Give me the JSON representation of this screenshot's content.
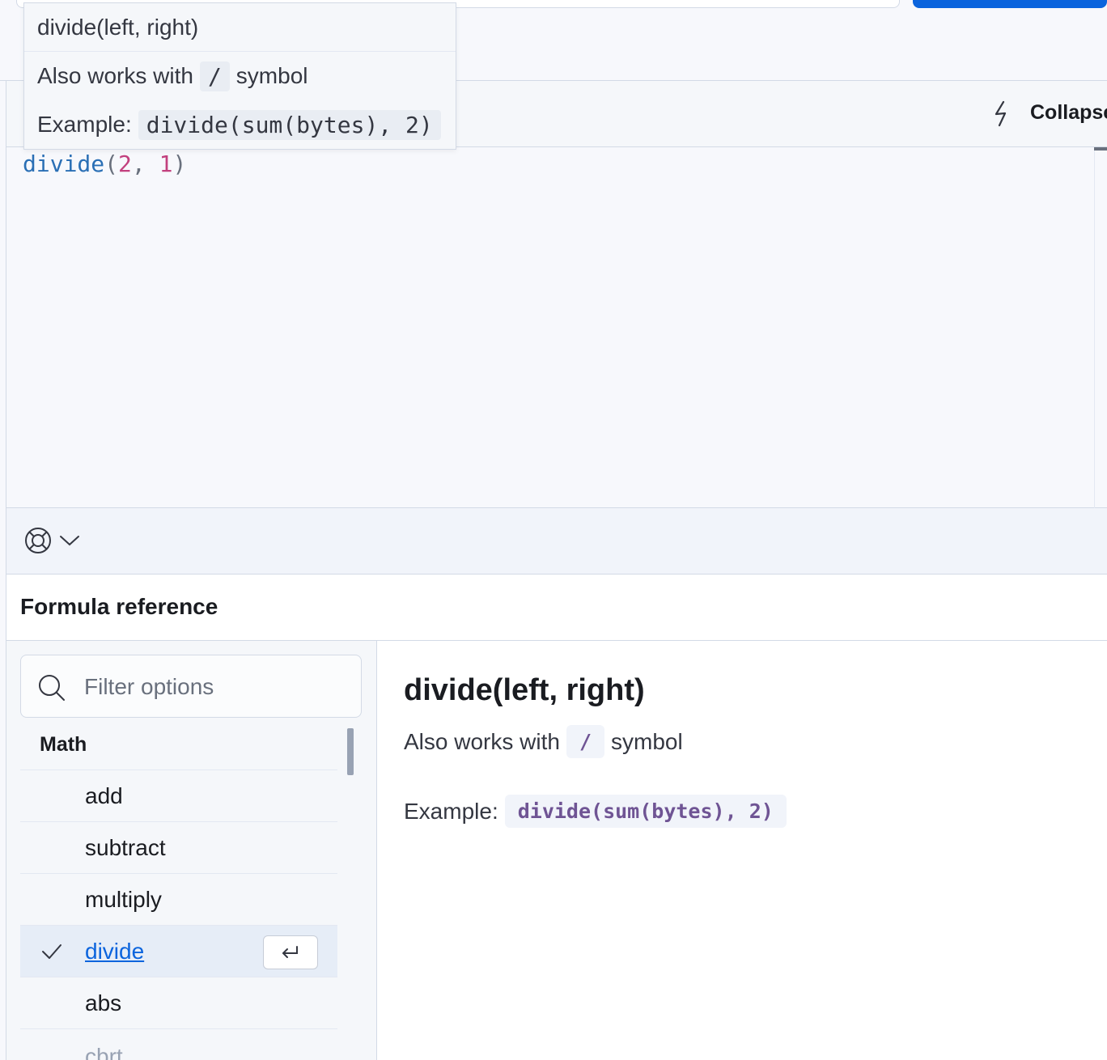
{
  "tooltip": {
    "signature": "divide(left, right)",
    "also_prefix": "Also works with",
    "symbol": "/",
    "also_suffix": "symbol",
    "example_label": "Example:",
    "example_code": "divide(sum(bytes), 2)"
  },
  "toolbar": {
    "collapse_label": "Collapse",
    "bolt_icon": "bolt-icon"
  },
  "editor": {
    "fn": "divide",
    "open": "(",
    "arg1": "2",
    "comma": ", ",
    "arg2": "1",
    "close": ")"
  },
  "footer": {
    "help_icon": "lifebuoy-icon",
    "chevron_icon": "chevron-down-icon"
  },
  "reference": {
    "title": "Formula reference",
    "filter_placeholder": "Filter options",
    "group": "Math",
    "items": [
      {
        "label": "add"
      },
      {
        "label": "subtract"
      },
      {
        "label": "multiply"
      },
      {
        "label": "divide"
      },
      {
        "label": "abs"
      },
      {
        "label": "cbrt"
      }
    ],
    "doc": {
      "title": "divide(left, right)",
      "also_prefix": "Also works with",
      "symbol": "/",
      "also_suffix": "symbol",
      "example_label": "Example:",
      "example_code": "divide(sum(bytes), 2)"
    }
  },
  "colors": {
    "accent": "#0b64dd",
    "code_purple": "#6f5494",
    "number_pink": "#c2407e",
    "fn_blue": "#2a6fb5"
  }
}
